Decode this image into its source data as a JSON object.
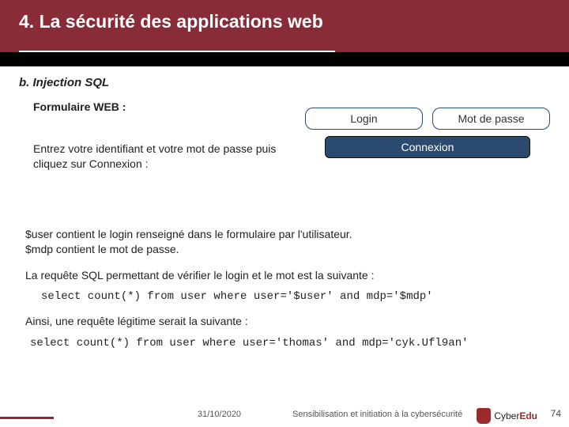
{
  "header": {
    "title": "4. La sécurité des applications web"
  },
  "section": {
    "subtitle": "b. Injection SQL",
    "form_label": "Formulaire WEB :",
    "instruction": "Entrez votre identifiant et votre mot de passe puis cliquez sur Connexion :",
    "login_placeholder": "Login",
    "password_placeholder": "Mot de passe",
    "connect_label": "Connexion"
  },
  "body": {
    "p1a": "$user contient le login renseigné dans le formulaire par l'utilisateur.",
    "p1b": "$mdp contient le mot de passe.",
    "p2": "La requête SQL permettant de vérifier le login et le mot est la suivante :",
    "code1": "select count(*) from user where user='$user' and mdp='$mdp'",
    "p3": "Ainsi, une requête légitime serait la suivante :",
    "code2": "select count(*) from user where user='thomas' and mdp='cyk.Ufl9an'"
  },
  "footer": {
    "date": "31/10/2020",
    "tagline": "Sensibilisation et initiation à la cybersécurité",
    "logo_prefix": "Cyber",
    "logo_suffix": "Edu",
    "page": "74"
  }
}
